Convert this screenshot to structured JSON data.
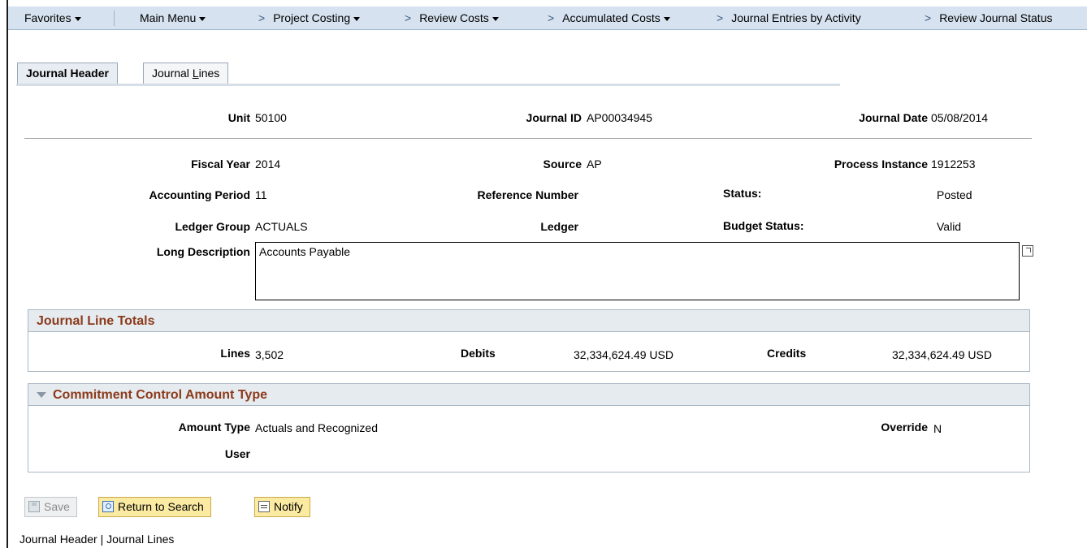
{
  "nav": {
    "favorites": "Favorites",
    "main_menu": "Main Menu",
    "crumbs": [
      "Project Costing",
      "Review Costs",
      "Accumulated Costs",
      "Journal Entries by Activity",
      "Review Journal Status"
    ],
    "crumb_arrow": ">"
  },
  "tabs": {
    "header": "Journal Header",
    "lines_prefix": "Journal ",
    "lines_accel": "L",
    "lines_suffix": "ines"
  },
  "header": {
    "unit_label": "Unit",
    "unit_value": "50100",
    "journal_id_label": "Journal ID",
    "journal_id_value": "AP00034945",
    "journal_date_label": "Journal Date",
    "journal_date_value": "05/08/2014",
    "fiscal_year_label": "Fiscal Year",
    "fiscal_year_value": "2014",
    "source_label": "Source",
    "source_value": "AP",
    "process_instance_label": "Process Instance",
    "process_instance_value": "1912253",
    "accounting_period_label": "Accounting Period",
    "accounting_period_value": "11",
    "reference_number_label": "Reference Number",
    "status_label": "Status:",
    "status_value": "Posted",
    "ledger_group_label": "Ledger Group",
    "ledger_group_value": "ACTUALS",
    "ledger_label": "Ledger",
    "budget_status_label": "Budget Status:",
    "budget_status_value": "Valid",
    "long_description_label": "Long Description",
    "long_description_value": "Accounts Payable"
  },
  "totals": {
    "title": "Journal Line Totals",
    "lines_label": "Lines",
    "lines_value": "3,502",
    "debits_label": "Debits",
    "debits_value": "32,334,624.49 USD",
    "credits_label": "Credits",
    "credits_value": "32,334,624.49 USD"
  },
  "commitment": {
    "title": "Commitment Control Amount Type",
    "amount_type_label": "Amount Type",
    "amount_type_value": "Actuals and Recognized",
    "override_label": "Override",
    "override_value": "N",
    "user_label": "User"
  },
  "buttons": {
    "save": "Save",
    "return_to_search": "Return to Search",
    "notify": "Notify"
  },
  "footer": {
    "link_header": "Journal Header",
    "separator": " | ",
    "link_lines": "Journal Lines"
  },
  "colors": {
    "nav_bg": "#d6e2ef",
    "group_title": "#8b3a1a",
    "button_yellow": "#fbeaa1"
  }
}
